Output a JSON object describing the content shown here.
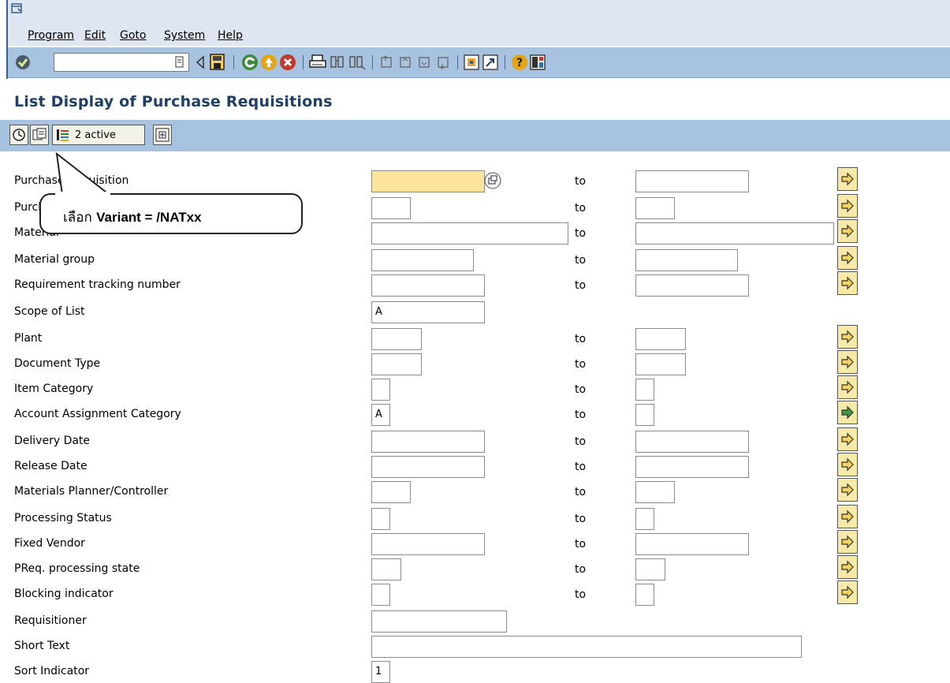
{
  "menubar": {
    "items": [
      "Program",
      "Edit",
      "Goto",
      "System",
      "Help"
    ]
  },
  "toolbar": {
    "command_value": "",
    "icons": [
      "check-icon",
      "history-icon",
      "back-arrow-icon",
      "save-icon",
      "back-icon",
      "exit-icon",
      "cancel-icon",
      "print-icon",
      "find-icon",
      "find-next-icon",
      "first-page-icon",
      "prev-page-icon",
      "next-page-icon",
      "last-page-icon",
      "new-session-icon",
      "shortcut-icon",
      "help-icon",
      "layout-icon"
    ]
  },
  "page": {
    "title": "List Display of Purchase Requisitions"
  },
  "app_toolbar": {
    "active_label": "2 active"
  },
  "callout": {
    "text_prefix": "เลือก ",
    "text_bold": "Variant = /NATxx"
  },
  "colors": {
    "header_bg": "#dde6f1",
    "toolbar_bg": "#a8c3e0",
    "title_color": "#1e3f67",
    "required_field": "#fbe59b"
  },
  "form": {
    "to_label": "to",
    "rows": [
      {
        "label": "Purchase Requisition",
        "from": "",
        "to": ""
      },
      {
        "label": "Purchase Requisition Item",
        "from": "",
        "to": ""
      },
      {
        "label": "Material",
        "from": "",
        "to": ""
      },
      {
        "label": "Material group",
        "from": "",
        "to": ""
      },
      {
        "label": "Requirement tracking number",
        "from": "",
        "to": ""
      },
      {
        "label": "Scope of List",
        "from": "A"
      },
      {
        "label": "Plant",
        "from": "",
        "to": ""
      },
      {
        "label": "Document Type",
        "from": "",
        "to": ""
      },
      {
        "label": "Item Category",
        "from": "",
        "to": ""
      },
      {
        "label": "Account Assignment Category",
        "from": "A",
        "to": ""
      },
      {
        "label": "Delivery Date",
        "from": "",
        "to": ""
      },
      {
        "label": "Release Date",
        "from": "",
        "to": ""
      },
      {
        "label": "Materials Planner/Controller",
        "from": "",
        "to": ""
      },
      {
        "label": "Processing Status",
        "from": "",
        "to": ""
      },
      {
        "label": "Fixed Vendor",
        "from": "",
        "to": ""
      },
      {
        "label": "PReq. processing state",
        "from": "",
        "to": ""
      },
      {
        "label": "Blocking indicator",
        "from": "",
        "to": ""
      },
      {
        "label": "Requisitioner",
        "from": ""
      },
      {
        "label": "Short Text",
        "from": ""
      },
      {
        "label": "Sort Indicator",
        "from": "1"
      }
    ]
  }
}
